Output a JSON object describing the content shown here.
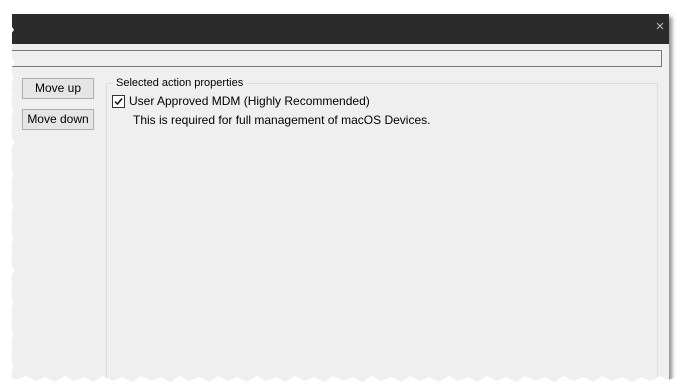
{
  "window": {
    "close_glyph": "×"
  },
  "buttons": {
    "move_up": "Move up",
    "move_down": "Move down"
  },
  "properties": {
    "legend": "Selected action properties",
    "checkbox_label": "User Approved MDM (Highly Recommended)",
    "checked": true,
    "description": "This is required for full management of macOS Devices."
  },
  "colors": {
    "titlebar": "#2b2b2b",
    "window_bg": "#efefef"
  },
  "icons": {
    "close": "close-icon",
    "check": "checkmark-icon"
  }
}
